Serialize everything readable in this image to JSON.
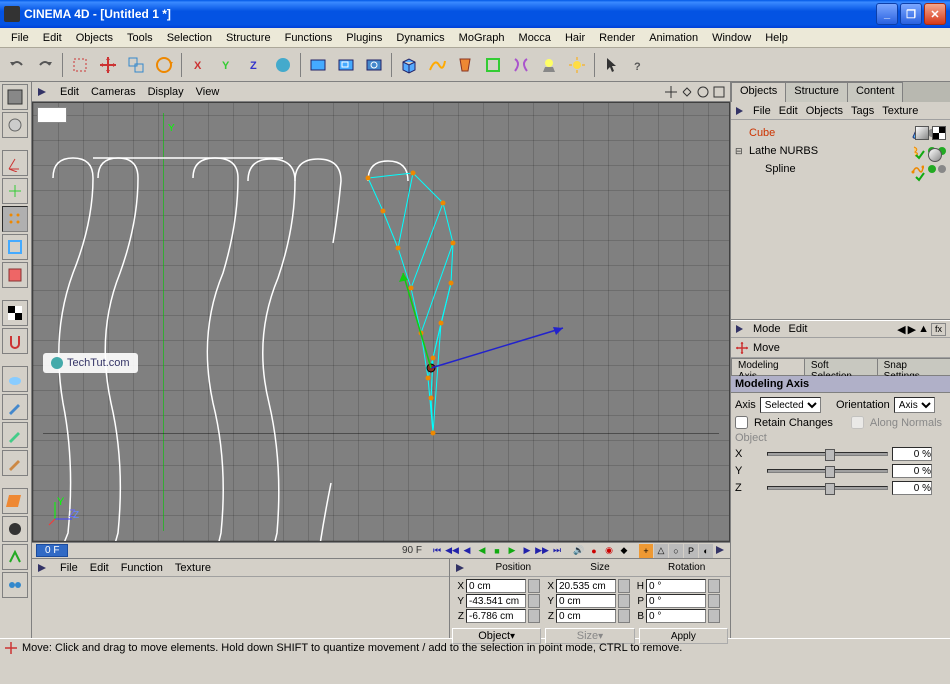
{
  "window": {
    "title": "CINEMA 4D - [Untitled 1 *]"
  },
  "menu": [
    "File",
    "Edit",
    "Objects",
    "Tools",
    "Selection",
    "Structure",
    "Functions",
    "Plugins",
    "Dynamics",
    "MoGraph",
    "Mocca",
    "Hair",
    "Render",
    "Animation",
    "Window",
    "Help"
  ],
  "viewport_menu": [
    "Edit",
    "Cameras",
    "Display",
    "View"
  ],
  "axis_labels": {
    "y": "Y",
    "z": "Z"
  },
  "watermark": "TechTut.com",
  "timeline": {
    "current": "0 F",
    "end": "90 F"
  },
  "material_menu": [
    "File",
    "Edit",
    "Function",
    "Texture"
  ],
  "coord": {
    "headers": [
      "Position",
      "Size",
      "Rotation"
    ],
    "rows": [
      {
        "label": "X",
        "pos": "0 cm",
        "size_label": "X",
        "size": "20.535 cm",
        "rot_label": "H",
        "rot": "0 °"
      },
      {
        "label": "Y",
        "pos": "-43.541 cm",
        "size_label": "Y",
        "size": "0 cm",
        "rot_label": "P",
        "rot": "0 °"
      },
      {
        "label": "Z",
        "pos": "-6.786 cm",
        "size_label": "Z",
        "size": "0 cm",
        "rot_label": "B",
        "rot": "0 °"
      }
    ],
    "buttons": {
      "object": "Object",
      "size": "Size",
      "apply": "Apply"
    }
  },
  "right_tabs": [
    "Objects",
    "Structure",
    "Content"
  ],
  "obj_menu": [
    "File",
    "Edit",
    "Objects",
    "Tags",
    "Texture"
  ],
  "tree": [
    {
      "name": "Cube",
      "selected": true,
      "icon": "cone",
      "indent": 0,
      "expander": ""
    },
    {
      "name": "Lathe NURBS",
      "selected": false,
      "icon": "lathe",
      "indent": 0,
      "expander": "⊟"
    },
    {
      "name": "Spline",
      "selected": false,
      "icon": "spline",
      "indent": 1,
      "expander": ""
    }
  ],
  "attr_bar": [
    "Mode",
    "Edit"
  ],
  "attr_header": "Move",
  "attr_tabs": [
    "Modeling Axis",
    "Soft Selection",
    "Snap Settings"
  ],
  "attr_section": "Modeling Axis",
  "attr": {
    "axis_label": "Axis",
    "axis_value": "Selected",
    "orientation_label": "Orientation",
    "orientation_value": "Axis",
    "retain": "Retain Changes",
    "along": "Along Normals",
    "object_label": "Object",
    "sliders": [
      {
        "label": "X",
        "value": "0 %"
      },
      {
        "label": "Y",
        "value": "0 %"
      },
      {
        "label": "Z",
        "value": "0 %"
      }
    ]
  },
  "statusbar": "Move: Click and drag to move elements. Hold down SHIFT to quantize movement / add to the selection in point mode, CTRL to remove."
}
